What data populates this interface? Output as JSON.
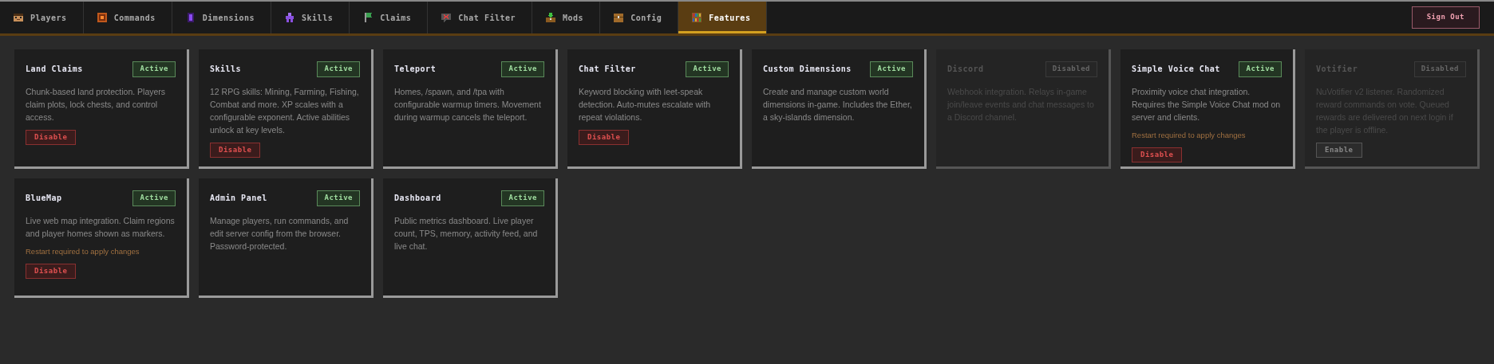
{
  "tabs": [
    {
      "label": "Players",
      "selected": false
    },
    {
      "label": "Commands",
      "selected": false
    },
    {
      "label": "Dimensions",
      "selected": false
    },
    {
      "label": "Skills",
      "selected": false
    },
    {
      "label": "Claims",
      "selected": false
    },
    {
      "label": "Chat Filter",
      "selected": false
    },
    {
      "label": "Mods",
      "selected": false
    },
    {
      "label": "Config",
      "selected": false
    },
    {
      "label": "Features",
      "selected": true
    }
  ],
  "sign_out": "Sign Out",
  "features": [
    {
      "title": "Land Claims",
      "status": "Active",
      "enabled": true,
      "description": "Chunk-based land protection. Players claim plots, lock chests, and control access.",
      "button": "Disable"
    },
    {
      "title": "Skills",
      "status": "Active",
      "enabled": true,
      "description": "12 RPG skills: Mining, Farming, Fishing, Combat and more. XP scales with a configurable exponent. Active abilities unlock at key levels.",
      "button": "Disable"
    },
    {
      "title": "Teleport",
      "status": "Active",
      "enabled": true,
      "description": "Homes, /spawn, and /tpa with configurable warmup timers. Movement during warmup cancels the teleport."
    },
    {
      "title": "Chat Filter",
      "status": "Active",
      "enabled": true,
      "description": "Keyword blocking with leet-speak detection. Auto-mutes escalate with repeat violations.",
      "button": "Disable"
    },
    {
      "title": "Custom Dimensions",
      "status": "Active",
      "enabled": true,
      "description": "Create and manage custom world dimensions in-game. Includes the Ether, a sky-islands dimension."
    },
    {
      "title": "Discord",
      "status": "Disabled",
      "enabled": false,
      "description": "Webhook integration. Relays in-game join/leave events and chat messages to a Discord channel."
    },
    {
      "title": "Simple Voice Chat",
      "status": "Active",
      "enabled": true,
      "description": "Proximity voice chat integration. Requires the Simple Voice Chat mod on server and clients.",
      "note": "Restart required to apply changes",
      "button": "Disable"
    },
    {
      "title": "Votifier",
      "status": "Disabled",
      "enabled": false,
      "description": "NuVotifier v2 listener. Randomized reward commands on vote. Queued rewards are delivered on next login if the player is offline.",
      "button": "Enable"
    },
    {
      "title": "BlueMap",
      "status": "Active",
      "enabled": true,
      "description": "Live web map integration. Claim regions and player homes shown as markers.",
      "note": "Restart required to apply changes",
      "button": "Disable"
    },
    {
      "title": "Admin Panel",
      "status": "Active",
      "enabled": true,
      "description": "Manage players, run commands, and edit server config from the browser. Password-protected."
    },
    {
      "title": "Dashboard",
      "status": "Active",
      "enabled": true,
      "description": "Public metrics dashboard. Live player count, TPS, memory, activity feed, and live chat."
    }
  ]
}
